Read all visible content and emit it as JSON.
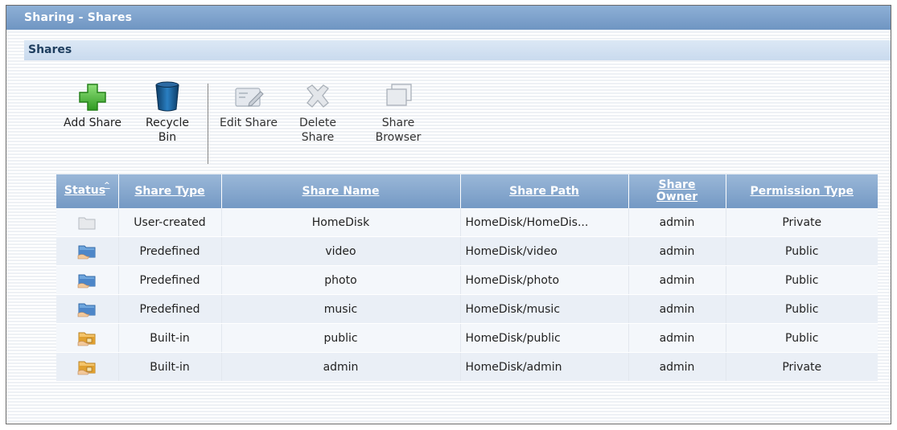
{
  "window": {
    "title": "Sharing - Shares"
  },
  "section": {
    "title": "Shares"
  },
  "toolbar": {
    "add_share": {
      "label": "Add Share",
      "icon": "add-icon",
      "enabled": true
    },
    "recycle_bin": {
      "label_line1": "Recycle",
      "label_line2": "Bin",
      "icon": "recycle-bin-icon",
      "enabled": true
    },
    "edit_share": {
      "label": "Edit Share",
      "icon": "edit-icon",
      "enabled": false
    },
    "delete_share": {
      "label_line1": "Delete",
      "label_line2": "Share",
      "icon": "delete-icon",
      "enabled": false
    },
    "share_browser": {
      "label_line1": "Share",
      "label_line2": "Browser",
      "icon": "browser-icon",
      "enabled": false
    }
  },
  "table": {
    "columns": {
      "status": "Status",
      "share_type": "Share Type",
      "share_name": "Share Name",
      "share_path": "Share Path",
      "share_owner_line1": "Share",
      "share_owner_line2": "Owner",
      "permission_type": "Permission Type"
    },
    "sorted_by": "status",
    "rows": [
      {
        "status_icon": "grey-folder-icon",
        "share_type": "User-created",
        "share_name": "HomeDisk",
        "share_path": "HomeDisk/HomeDis...",
        "share_owner": "admin",
        "permission_type": "Private"
      },
      {
        "status_icon": "blue-shared-folder-icon",
        "share_type": "Predefined",
        "share_name": "video",
        "share_path": "HomeDisk/video",
        "share_owner": "admin",
        "permission_type": "Public"
      },
      {
        "status_icon": "blue-shared-folder-icon",
        "share_type": "Predefined",
        "share_name": "photo",
        "share_path": "HomeDisk/photo",
        "share_owner": "admin",
        "permission_type": "Public"
      },
      {
        "status_icon": "blue-shared-folder-icon",
        "share_type": "Predefined",
        "share_name": "music",
        "share_path": "HomeDisk/music",
        "share_owner": "admin",
        "permission_type": "Public"
      },
      {
        "status_icon": "orange-locked-folder-icon",
        "share_type": "Built-in",
        "share_name": "public",
        "share_path": "HomeDisk/public",
        "share_owner": "admin",
        "permission_type": "Public"
      },
      {
        "status_icon": "orange-locked-folder-icon",
        "share_type": "Built-in",
        "share_name": "admin",
        "share_path": "HomeDisk/admin",
        "share_owner": "admin",
        "permission_type": "Private"
      }
    ]
  },
  "colors": {
    "title_bar": "#7fa2cc",
    "header": "#7499c4",
    "accent_green": "#3cb52c",
    "folder_blue": "#4d86c8",
    "folder_orange": "#e0a030"
  }
}
